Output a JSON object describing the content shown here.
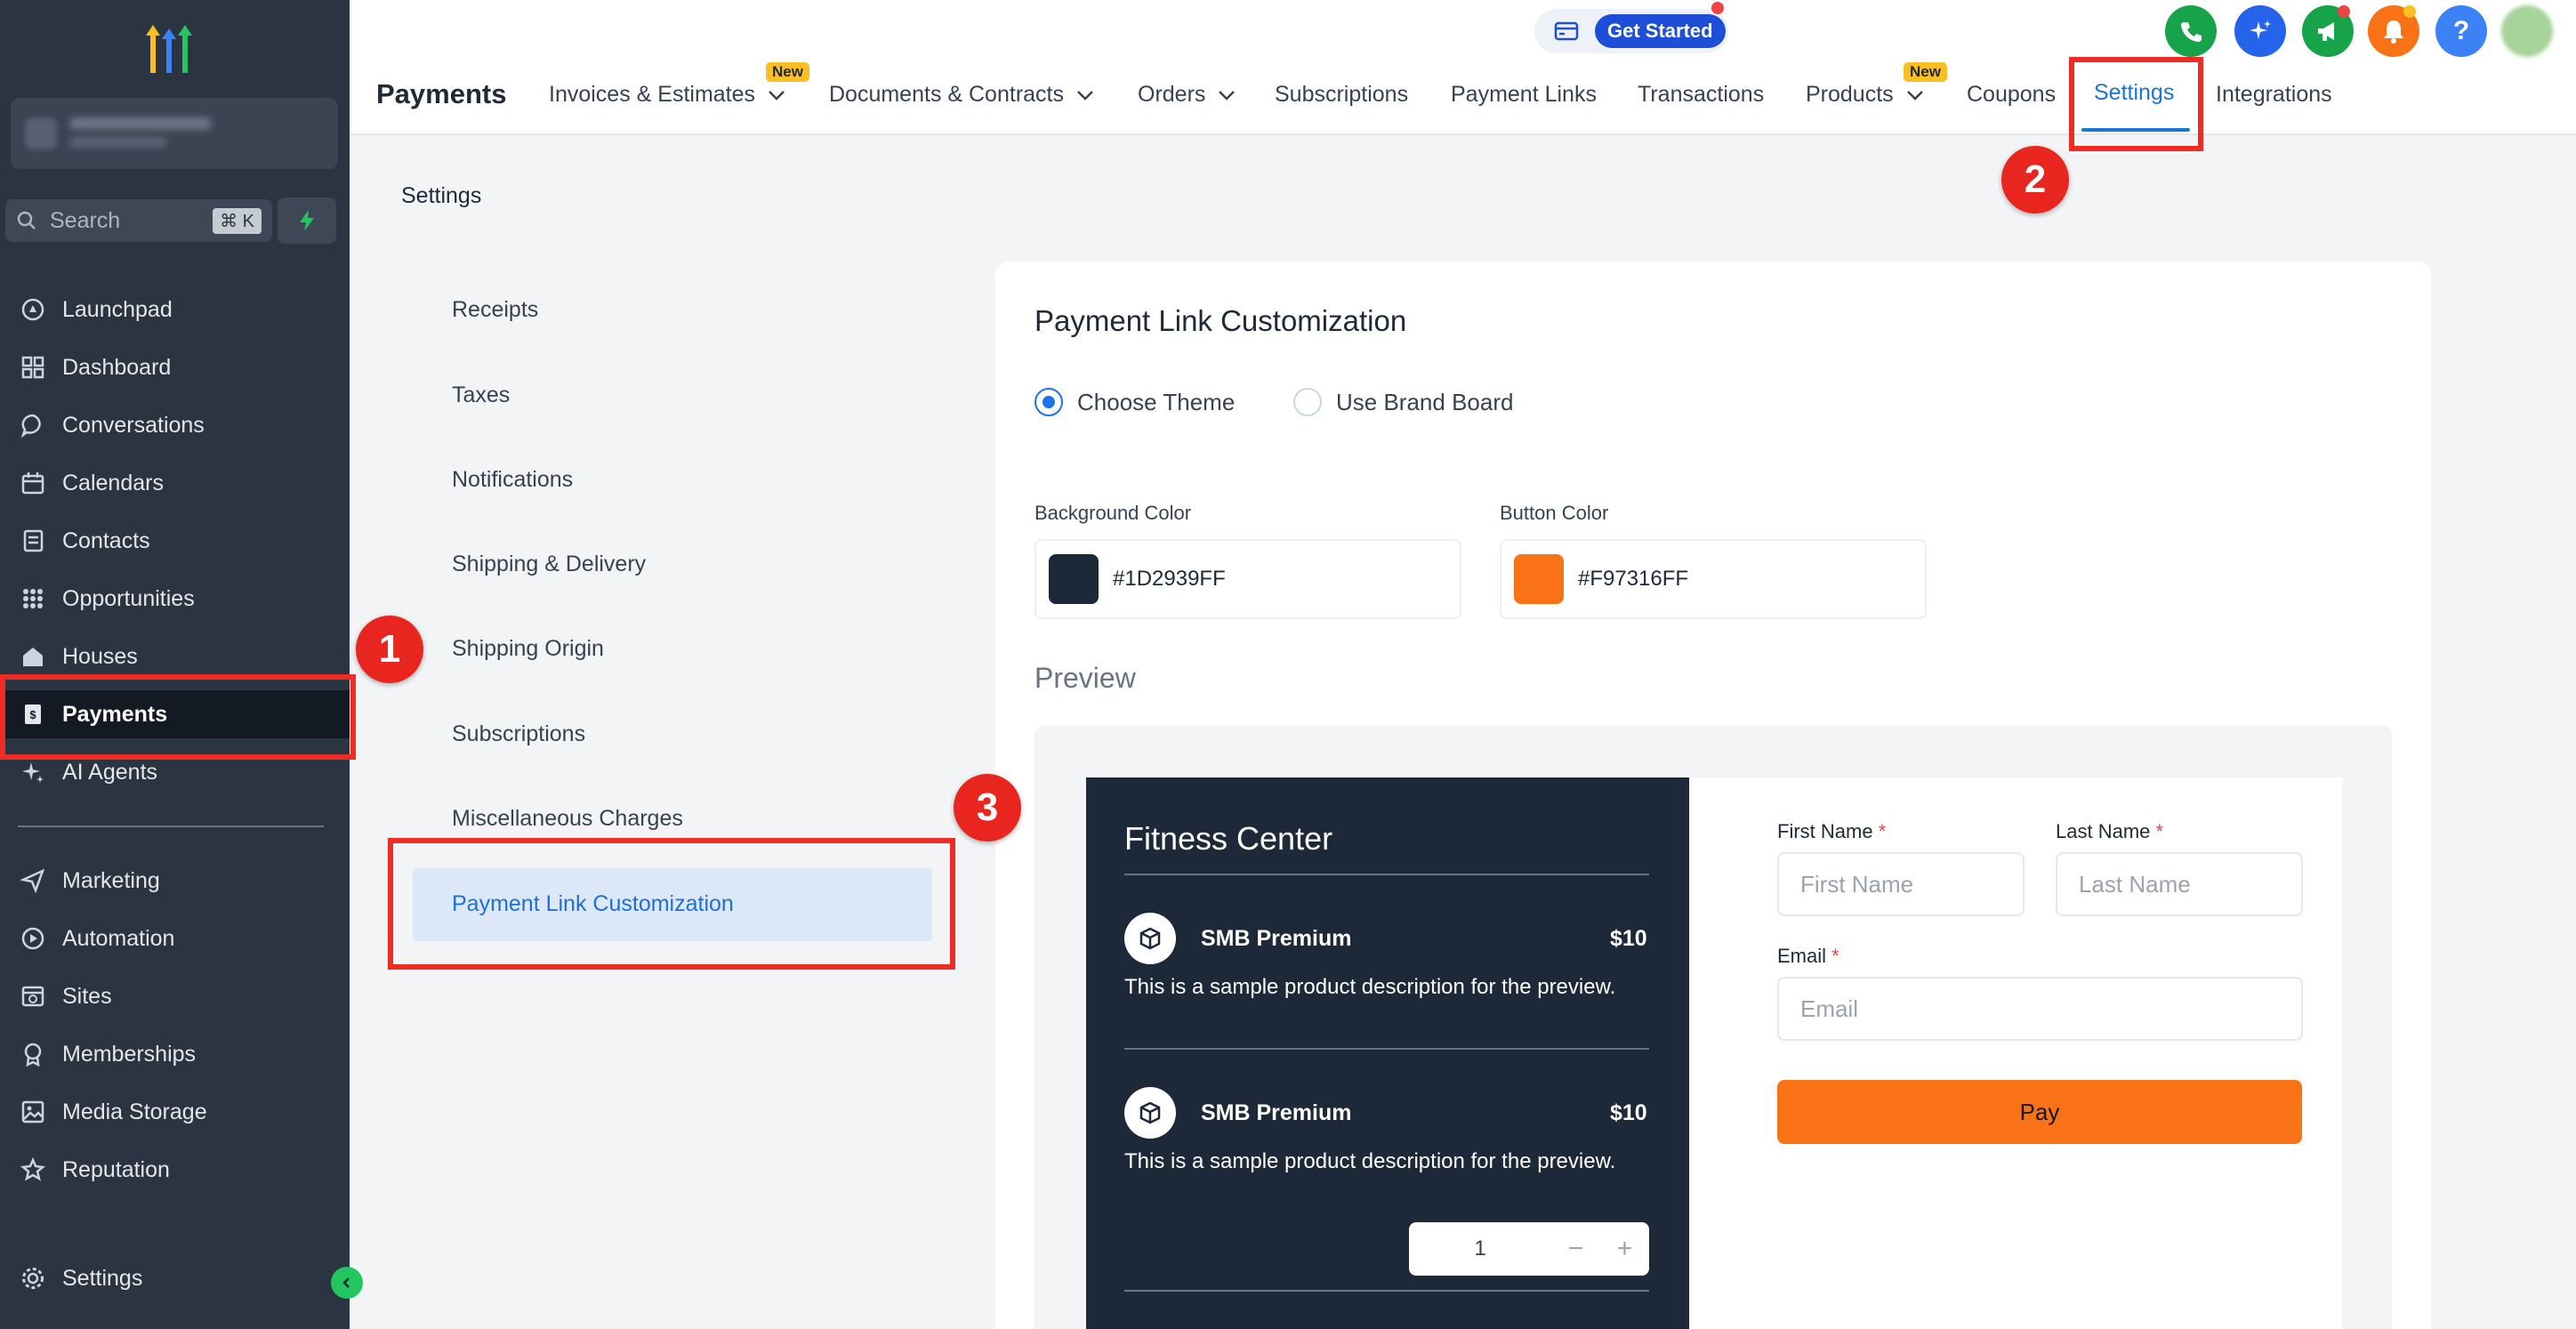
{
  "sidebar": {
    "search": {
      "label": "Search",
      "shortcut": "⌘ K"
    },
    "items": [
      {
        "label": "Launchpad",
        "icon": "rocket-icon"
      },
      {
        "label": "Dashboard",
        "icon": "grid-icon"
      },
      {
        "label": "Conversations",
        "icon": "chat-icon"
      },
      {
        "label": "Calendars",
        "icon": "calendar-icon"
      },
      {
        "label": "Contacts",
        "icon": "contacts-icon"
      },
      {
        "label": "Opportunities",
        "icon": "opportunities-icon"
      },
      {
        "label": "Houses",
        "icon": "house-icon"
      },
      {
        "label": "Payments",
        "icon": "payments-icon",
        "active": true
      },
      {
        "label": "AI Agents",
        "icon": "sparkle-icon"
      }
    ],
    "items2": [
      {
        "label": "Marketing",
        "icon": "send-icon"
      },
      {
        "label": "Automation",
        "icon": "automation-icon"
      },
      {
        "label": "Sites",
        "icon": "sites-icon"
      },
      {
        "label": "Memberships",
        "icon": "badge-icon"
      },
      {
        "label": "Media Storage",
        "icon": "image-icon"
      },
      {
        "label": "Reputation",
        "icon": "star-icon"
      }
    ],
    "settings_label": "Settings"
  },
  "header": {
    "title": "Payments",
    "tabs": [
      {
        "label": "Invoices & Estimates",
        "dropdown": true,
        "badge": "New"
      },
      {
        "label": "Documents & Contracts",
        "dropdown": true
      },
      {
        "label": "Orders",
        "dropdown": true
      },
      {
        "label": "Subscriptions"
      },
      {
        "label": "Payment Links"
      },
      {
        "label": "Transactions"
      },
      {
        "label": "Products",
        "dropdown": true,
        "badge": "New"
      },
      {
        "label": "Coupons"
      },
      {
        "label": "Settings",
        "active": true
      },
      {
        "label": "Integrations"
      }
    ],
    "get_started": "Get Started",
    "icon_colors": {
      "phone": "#16a34a",
      "sparkle": "#2563eb",
      "megaphone": "#16a34a",
      "bell": "#f97316",
      "help": "#3b82f6"
    }
  },
  "settings": {
    "heading": "Settings",
    "nav": [
      "Receipts",
      "Taxes",
      "Notifications",
      "Shipping & Delivery",
      "Shipping Origin",
      "Subscriptions",
      "Miscellaneous Charges",
      "Payment Link Customization"
    ],
    "active": "Payment Link Customization"
  },
  "customization": {
    "title": "Payment Link Customization",
    "theme_options": [
      "Choose Theme",
      "Use Brand Board"
    ],
    "selected_theme": "Choose Theme",
    "background_color_label": "Background Color",
    "background_color": "#1D2939FF",
    "button_color_label": "Button Color",
    "button_color": "#F97316FF",
    "preview_label": "Preview"
  },
  "preview": {
    "store_name": "Fitness Center",
    "products": [
      {
        "name": "SMB Premium",
        "price": "$10",
        "description": "This is a sample product description for the preview."
      },
      {
        "name": "SMB Premium",
        "price": "$10",
        "description": "This is a sample product description for the preview."
      }
    ],
    "quantity": "1",
    "form": {
      "first_name_label": "First Name",
      "first_name_placeholder": "First Name",
      "last_name_label": "Last Name",
      "last_name_placeholder": "Last Name",
      "email_label": "Email",
      "email_placeholder": "Email",
      "required_mark": "*",
      "pay_label": "Pay"
    }
  },
  "annotations": [
    "1",
    "2",
    "3"
  ]
}
